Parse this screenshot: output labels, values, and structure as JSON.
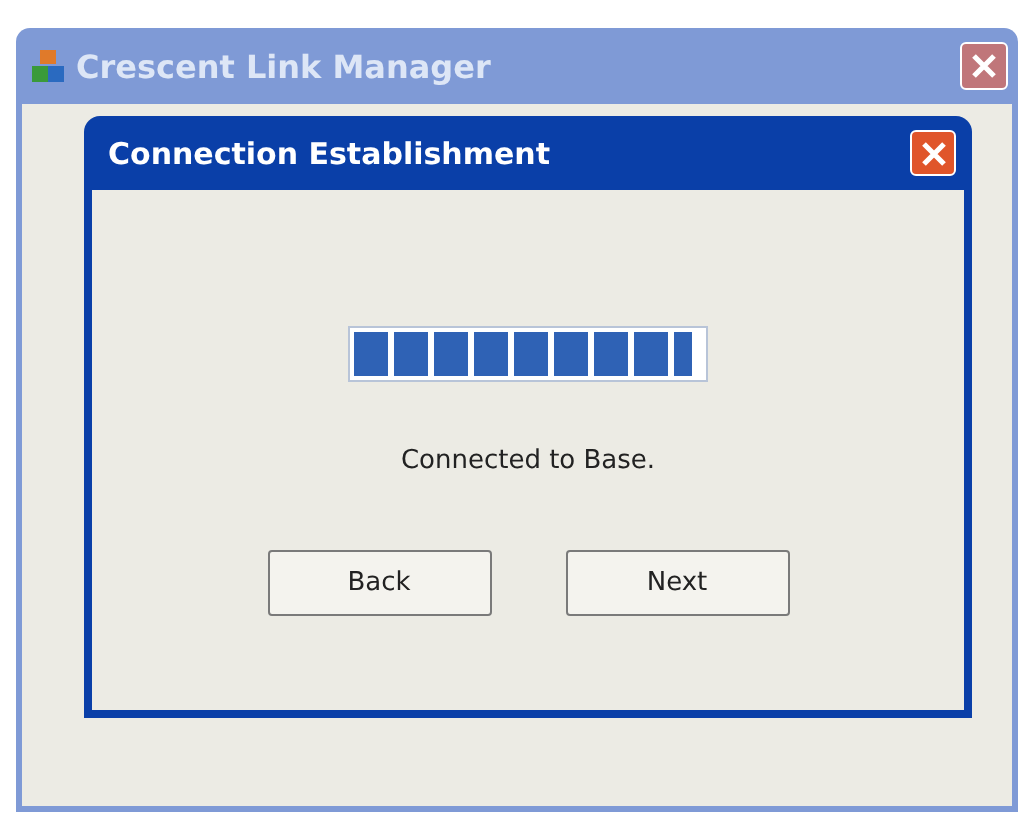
{
  "window": {
    "title": "Crescent Link Manager"
  },
  "dialog": {
    "title": "Connection Establishment",
    "progress": {
      "level": 0.97
    },
    "status": "Connected to Base.",
    "buttons": [
      "Back",
      "Next"
    ]
  }
}
